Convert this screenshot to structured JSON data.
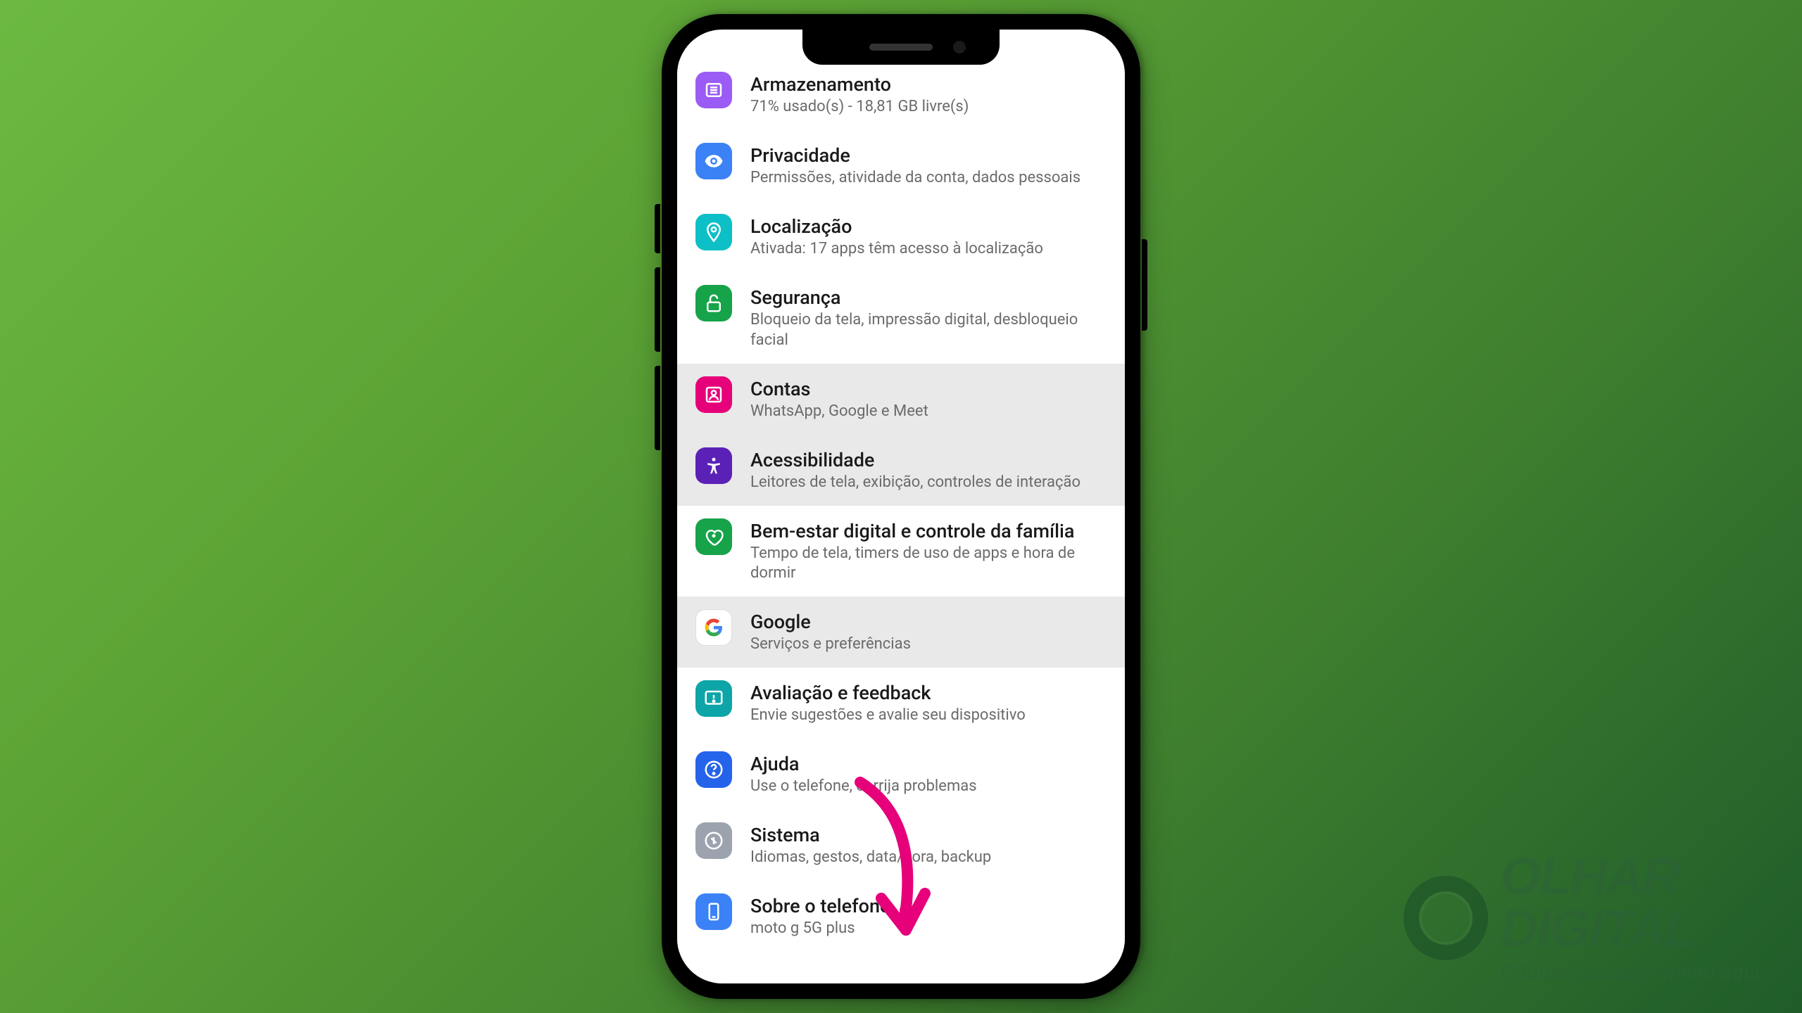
{
  "settings": {
    "items": [
      {
        "id": "storage",
        "title": "Armazenamento",
        "sub": "71% usado(s) - 18,81 GB livre(s)",
        "color": "#9B5CF5",
        "grey": false
      },
      {
        "id": "privacy",
        "title": "Privacidade",
        "sub": "Permissões, atividade da conta, dados pessoais",
        "color": "#3B82F6",
        "grey": false
      },
      {
        "id": "location",
        "title": "Localização",
        "sub": "Ativada: 17 apps têm acesso à localização",
        "color": "#0DBFC6",
        "grey": false
      },
      {
        "id": "security",
        "title": "Segurança",
        "sub": "Bloqueio da tela, impressão digital, desbloqueio facial",
        "color": "#16A34A",
        "grey": false
      },
      {
        "id": "accounts",
        "title": "Contas",
        "sub": "WhatsApp, Google e Meet",
        "color": "#E6007A",
        "grey": true
      },
      {
        "id": "accessibility",
        "title": "Acessibilidade",
        "sub": "Leitores de tela, exibição, controles de interação",
        "color": "#5B21B6",
        "grey": true
      },
      {
        "id": "wellbeing",
        "title": "Bem-estar digital e controle da família",
        "sub": "Tempo de tela, timers de uso de apps e hora de dormir",
        "color": "#16A34A",
        "grey": false
      },
      {
        "id": "google",
        "title": "Google",
        "sub": "Serviços e preferências",
        "color": "#FFFFFF",
        "grey": true
      },
      {
        "id": "feedback",
        "title": "Avaliação e feedback",
        "sub": "Envie sugestões e avalie seu dispositivo",
        "color": "#0DA5A8",
        "grey": false
      },
      {
        "id": "help",
        "title": "Ajuda",
        "sub": "Use o telefone, corrija problemas",
        "color": "#2563EB",
        "grey": false
      },
      {
        "id": "system",
        "title": "Sistema",
        "sub": "Idiomas, gestos, data/hora, backup",
        "color": "#9CA3AF",
        "grey": false
      },
      {
        "id": "about",
        "title": "Sobre o telefone",
        "sub": "moto g 5G plus",
        "color": "#3B82F6",
        "grey": false
      }
    ]
  },
  "annotation": {
    "arrow_color": "#E6007A"
  },
  "branding": {
    "line1": "OLHAR",
    "line2": "DIGITAL",
    "tagline": "O futuro passa primeiro aqui"
  }
}
